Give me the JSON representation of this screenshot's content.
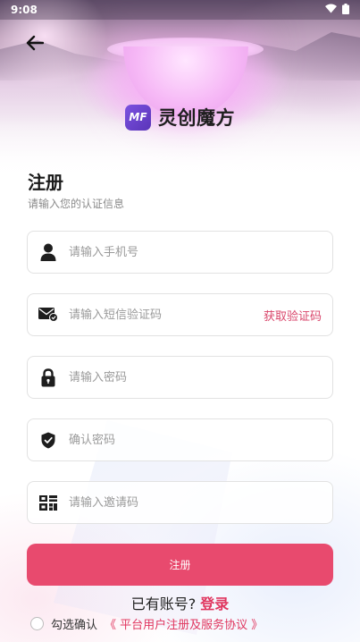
{
  "status_bar": {
    "time": "9:08",
    "icons": [
      "wifi-icon",
      "battery-icon"
    ]
  },
  "header": {
    "back_icon": "arrow-left-icon",
    "logo_badge": "MF",
    "logo_text": "灵创魔方"
  },
  "form": {
    "title": "注册",
    "subtitle": "请输入您的认证信息",
    "fields": {
      "phone": {
        "placeholder": "请输入手机号",
        "value": "",
        "icon": "user-icon"
      },
      "sms_code": {
        "placeholder": "请输入短信验证码",
        "value": "",
        "icon": "mail-icon",
        "action_label": "获取验证码"
      },
      "password": {
        "placeholder": "请输入密码",
        "value": "",
        "icon": "lock-icon"
      },
      "confirm_password": {
        "placeholder": "确认密码",
        "value": "",
        "icon": "shield-icon"
      },
      "invite_code": {
        "placeholder": "请输入邀请码",
        "value": "",
        "icon": "qr-code-icon"
      }
    },
    "submit_label": "注册",
    "login_prompt": "已有账号?",
    "login_link": "登录",
    "agree_prefix": "勾选确认",
    "agreement_link": "《 平台用户注册及服务协议 》"
  },
  "colors": {
    "accent": "#e84a6e",
    "link": "#e0365f",
    "logo": "#6a42cc"
  }
}
